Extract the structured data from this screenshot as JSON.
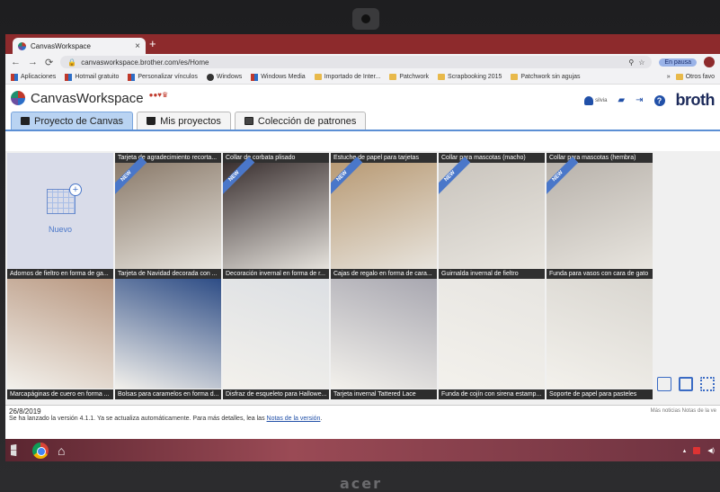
{
  "browser": {
    "tab_title": "CanvasWorkspace",
    "url": "canvasworkspace.brother.com/es/Home",
    "paused_label": "En pausa",
    "bookmarks": [
      "Aplicaciones",
      "Hotmail gratuito",
      "Personalizar vínculos",
      "Windows",
      "Windows Media",
      "Importado de Inter...",
      "Patchwork",
      "Scrapbooking 2015",
      "Patchwork sin agujas"
    ],
    "other_bookmarks": "Otros favo"
  },
  "app": {
    "name": "CanvasWorkspace",
    "user_name": "silvia",
    "brand": "broth"
  },
  "tabs": [
    {
      "label": "Proyecto de Canvas",
      "active": true
    },
    {
      "label": "Mis proyectos",
      "active": false
    },
    {
      "label": "Colección de patrones",
      "active": false
    }
  ],
  "new_tile_label": "Nuevo",
  "badge_new": "NEW",
  "tiles_row1": [
    {
      "caption": "Tarjeta de agradecimiento recorta...",
      "new": true,
      "color": "#8a7a6a"
    },
    {
      "caption": "Collar de corbata plisado",
      "new": true,
      "color": "#3a3030"
    },
    {
      "caption": "Estuche de papel para tarjetas",
      "new": true,
      "color": "#b89a74"
    },
    {
      "caption": "Collar para mascotas (macho)",
      "new": true,
      "color": "#c9c4bd"
    },
    {
      "caption": "Collar para mascotas (hembra)",
      "new": true,
      "color": "#b8b2ab"
    }
  ],
  "tiles_row2": [
    {
      "caption": "Adornos de fieltro en forma de ga...",
      "color": "#b89780"
    },
    {
      "caption": "Tarjeta de Navidad decorada con ...",
      "color": "#2e4d86"
    },
    {
      "caption": "Decoración invernal en forma de r...",
      "color": "#dcdfe3"
    },
    {
      "caption": "Cajas de regalo en forma de cara...",
      "color": "#a8a7b0"
    },
    {
      "caption": "Guirnalda invernal de fieltro",
      "color": "#e7e5e1"
    },
    {
      "caption": "Funda para vasos con cara de gato",
      "color": "#d9d6d0"
    }
  ],
  "tiles_row3": [
    "Marcapáginas de cuero en forma ...",
    "Bolsas para caramelos en forma d...",
    "Disfraz de esqueleto para Hallowe...",
    "Tarjeta invernal Tattered Lace",
    "Funda de cojín con sirena estamp...",
    "Soporte de papel para pasteles"
  ],
  "notice": {
    "date": "26/8/2019",
    "text": "Se ha lanzado la versión 4.1.1. Ya se actualiza automáticamente. Para más detalles, lea las",
    "link": "Notas de la versión",
    "end": ".",
    "right": "Más noticias   Notas de la ve"
  },
  "laptop_brand": "acer"
}
